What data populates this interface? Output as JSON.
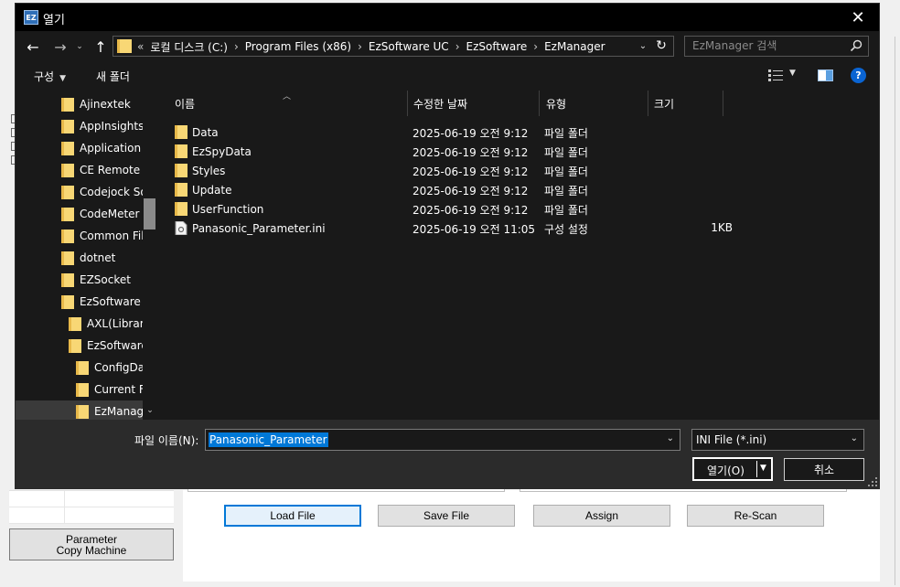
{
  "dialog": {
    "title": "열기",
    "app_icon_text": "EZ"
  },
  "address": {
    "overflow": "«",
    "crumbs": [
      "로컬 디스크 (C:)",
      "Program Files (x86)",
      "EzSoftware UC",
      "EzSoftware",
      "EzManager"
    ]
  },
  "search": {
    "placeholder": "EzManager 검색"
  },
  "toolbar": {
    "organize_label": "구성",
    "new_folder_label": "새 폴더"
  },
  "nav_tree": [
    "Ajinextek",
    "AppInsights",
    "Application V",
    "CE Remote T",
    "Codejock So",
    "CodeMeter",
    "Common Fil",
    "dotnet",
    "EZSocket",
    "EzSoftware U",
    "AXL(Library",
    "EzSoftware",
    "ConfigDa",
    "Current F",
    "EzManag"
  ],
  "columns": {
    "name": "이름",
    "date": "수정한 날짜",
    "type": "유형",
    "size": "크기"
  },
  "files": [
    {
      "name": "Data",
      "date": "2025-06-19 오전 9:12",
      "type": "파일 폴더",
      "size": "",
      "kind": "folder"
    },
    {
      "name": "EzSpyData",
      "date": "2025-06-19 오전 9:12",
      "type": "파일 폴더",
      "size": "",
      "kind": "folder"
    },
    {
      "name": "Styles",
      "date": "2025-06-19 오전 9:12",
      "type": "파일 폴더",
      "size": "",
      "kind": "folder"
    },
    {
      "name": "Update",
      "date": "2025-06-19 오전 9:12",
      "type": "파일 폴더",
      "size": "",
      "kind": "folder"
    },
    {
      "name": "UserFunction",
      "date": "2025-06-19 오전 9:12",
      "type": "파일 폴더",
      "size": "",
      "kind": "folder"
    },
    {
      "name": "Panasonic_Parameter.ini",
      "date": "2025-06-19 오전 11:05",
      "type": "구성 설정",
      "size": "1KB",
      "kind": "file"
    }
  ],
  "bottom": {
    "filename_label": "파일 이름(N):",
    "filename_value": "Panasonic_Parameter",
    "filetype_value": "INI File (*.ini)",
    "open_label": "열기(O)",
    "cancel_label": "취소"
  },
  "background_app": {
    "buttons": {
      "load": "Load File",
      "save": "Save File",
      "assign": "Assign",
      "rescan": "Re-Scan"
    },
    "param_button": {
      "line1": "Parameter",
      "line2": "Copy Machine"
    }
  },
  "colors": {
    "dialog_bg": "#191919",
    "titlebar_bg": "#000000",
    "footer_bg": "#2b2b2b",
    "selection": "#0078d7",
    "folder": "#f8d775",
    "help": "#0a64d2"
  }
}
